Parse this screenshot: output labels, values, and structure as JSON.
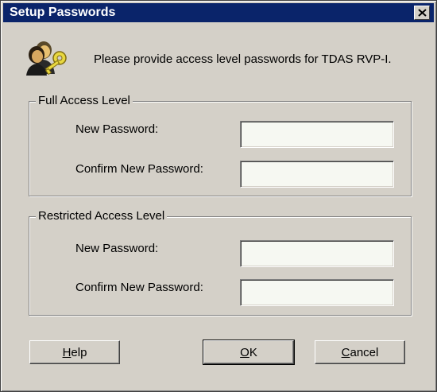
{
  "window": {
    "title": "Setup Passwords"
  },
  "message": "Please provide access level passwords for TDAS RVP-I.",
  "full_access": {
    "legend": "Full Access Level",
    "new_password_label": "New Password:",
    "confirm_password_label": "Confirm New Password:",
    "new_password_value": "",
    "confirm_password_value": ""
  },
  "restricted_access": {
    "legend": "Restricted Access Level",
    "new_password_label": "New Password:",
    "confirm_password_label": "Confirm New Password:",
    "new_password_value": "",
    "confirm_password_value": ""
  },
  "buttons": {
    "help": "Help",
    "ok": "OK",
    "cancel": "Cancel"
  },
  "icons": {
    "close": "close-icon",
    "users_key": "users-key-icon"
  },
  "colors": {
    "titlebar": "#0a246a",
    "dialog_bg": "#d4d0c8",
    "field_bg": "#f6f8f2"
  }
}
